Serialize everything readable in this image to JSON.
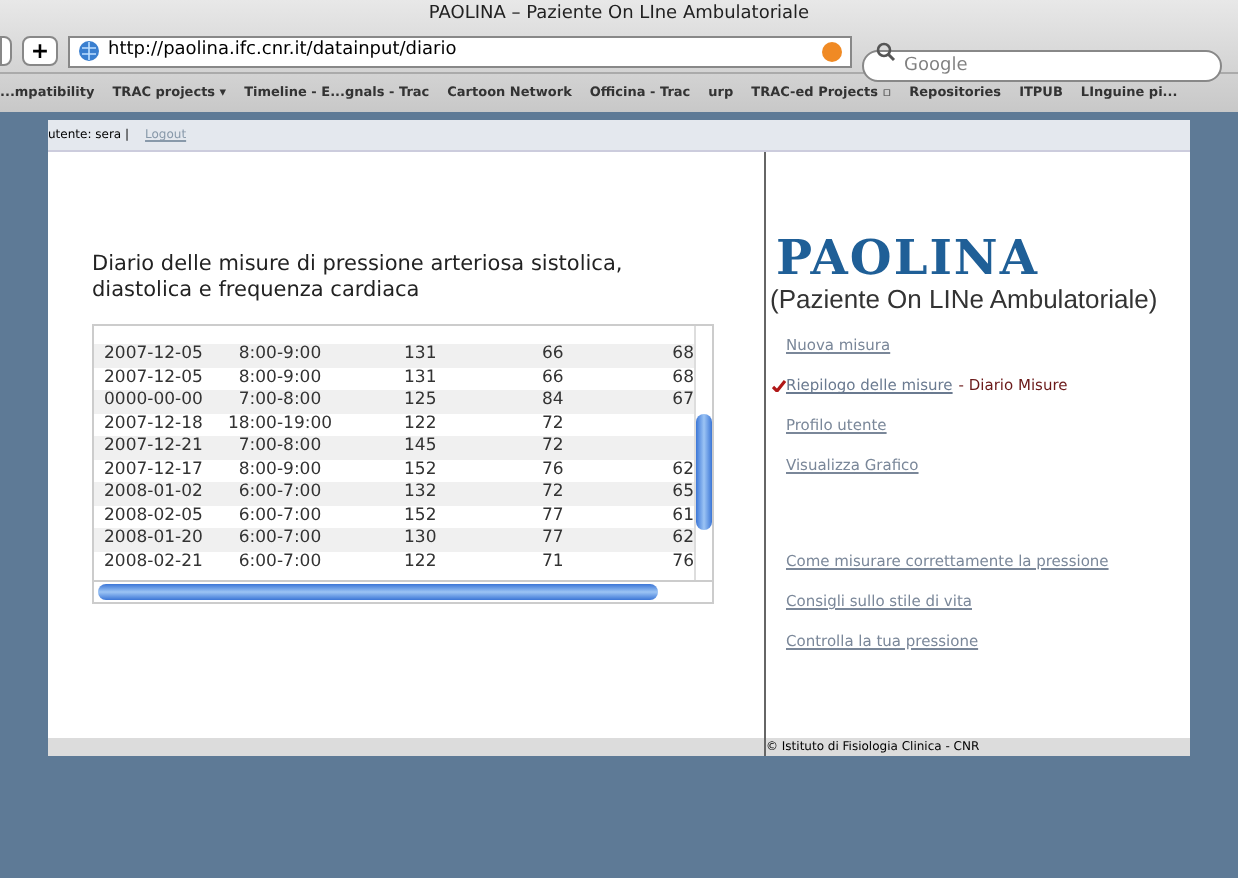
{
  "window": {
    "title": "PAOLINA – Paziente On LIne Ambulatoriale"
  },
  "toolbar": {
    "new_tab": "+",
    "url": "http://paolina.ifc.cnr.it/datainput/diario",
    "search": {
      "placeholder": "Google"
    }
  },
  "bookmarks": [
    "...mpatibility",
    "TRAC projects ▾",
    "Timeline - E...gnals - Trac",
    "Cartoon Network",
    "Officina - Trac",
    "urp",
    "TRAC-ed Projects ▫",
    "Repositories",
    "ITPUB",
    "LInguine pi..."
  ],
  "header": {
    "user": "utente: sera |",
    "logout": "Logout"
  },
  "heading": "Diario delle misure di pressione arteriosa sistolica, diastolica e frequenza cardiaca",
  "table": {
    "rows": [
      [
        "2007-12-05",
        "8:00-9:00",
        "131",
        "66",
        "68"
      ],
      [
        "2007-12-05",
        "8:00-9:00",
        "131",
        "66",
        "68"
      ],
      [
        "0000-00-00",
        "7:00-8:00",
        "125",
        "84",
        "67"
      ],
      [
        "2007-12-18",
        "18:00-19:00",
        "122",
        "72",
        ""
      ],
      [
        "2007-12-21",
        "7:00-8:00",
        "145",
        "72",
        ""
      ],
      [
        "2007-12-17",
        "8:00-9:00",
        "152",
        "76",
        "62"
      ],
      [
        "2008-01-02",
        "6:00-7:00",
        "132",
        "72",
        "65"
      ],
      [
        "2008-02-05",
        "6:00-7:00",
        "152",
        "77",
        "61"
      ],
      [
        "2008-01-20",
        "6:00-7:00",
        "130",
        "77",
        "62"
      ],
      [
        "2008-02-21",
        "6:00-7:00",
        "122",
        "71",
        "76"
      ]
    ]
  },
  "logo": {
    "title": "PAOLINA",
    "subtitle": "(Paziente On LINe Ambulatoriale)"
  },
  "menu": [
    {
      "label": "Nuova misura",
      "selected": false
    },
    {
      "label": "Riepilogo delle misure",
      "selected": true,
      "note": "- Diario Misure"
    },
    {
      "label": "Profilo utente",
      "selected": false
    },
    {
      "label": "Visualizza Grafico",
      "selected": false
    }
  ],
  "links": [
    "Come misurare correttamente la pressione",
    "Consigli sullo stile di vita",
    "Controlla la tua pressione"
  ],
  "footer": "© Istituto di Fisiologia Clinica - CNR"
}
